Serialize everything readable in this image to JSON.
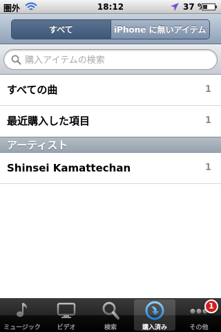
{
  "status_bar": {
    "carrier": "圏外",
    "time": "18:12",
    "battery": "37 %",
    "icons": [
      "wifi-icon",
      "location-arrow-icon",
      "battery-icon"
    ]
  },
  "segmented": {
    "options": [
      {
        "label": "すべて",
        "selected": true
      },
      {
        "label": "iPhone に無いアイテム",
        "selected": false
      }
    ]
  },
  "search": {
    "placeholder": "購入アイテムの検索",
    "value": "",
    "icon": "search-icon"
  },
  "list": {
    "rows": [
      {
        "label": "すべての曲",
        "count": "1"
      },
      {
        "label": "最近購入した項目",
        "count": "1"
      }
    ],
    "sections": [
      {
        "header": "アーティスト",
        "rows": [
          {
            "label": "Shinsei Kamattechan",
            "count": "1"
          }
        ]
      }
    ]
  },
  "tab_bar": {
    "tabs": [
      {
        "label": "ミュージック",
        "icon": "music-note-icon",
        "selected": false
      },
      {
        "label": "ビデオ",
        "icon": "tv-icon",
        "selected": false
      },
      {
        "label": "検索",
        "icon": "search-icon",
        "selected": false
      },
      {
        "label": "購入済み",
        "icon": "download-icon",
        "selected": true
      },
      {
        "label": "その他",
        "icon": "more-icon",
        "selected": false,
        "badge": "1"
      }
    ]
  },
  "colors": {
    "nav_tint": "#8fa2b8",
    "badge": "#d21f1f",
    "tab_selected_icon": "#3ea2e6"
  }
}
